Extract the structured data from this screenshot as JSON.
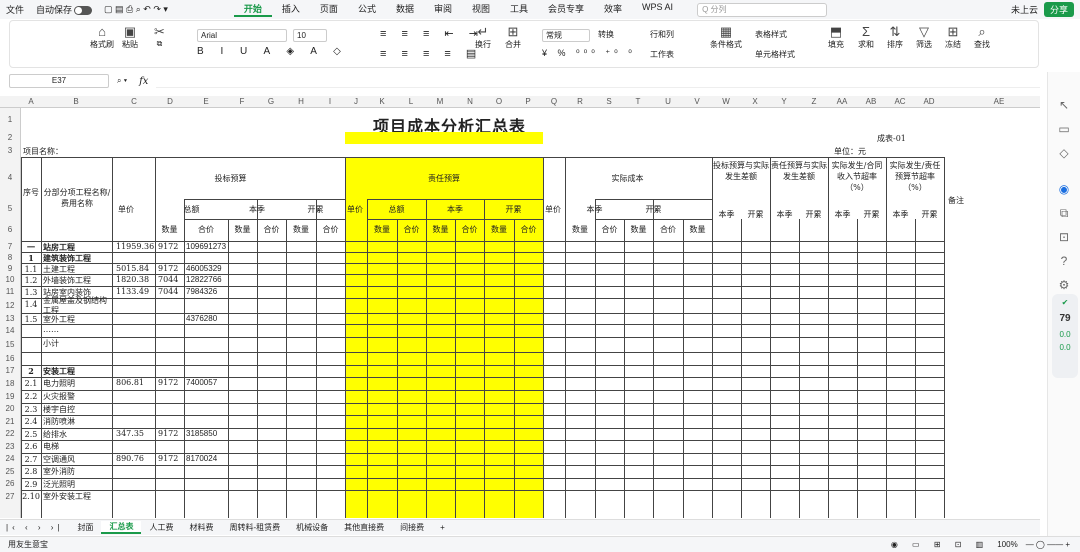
{
  "menubar": {
    "file": "文件",
    "autosave": "自动保存",
    "tabs": [
      "开始",
      "插入",
      "页面",
      "公式",
      "数据",
      "审阅",
      "视图",
      "工具",
      "会员专享",
      "效率",
      "WPS AI"
    ],
    "active_tab": "开始",
    "search_placeholder": "Q 分列",
    "cloud": "未上云",
    "share": "分享"
  },
  "ribbon": {
    "format_painter": "格式刷",
    "paste": "粘贴",
    "font": "Arial",
    "size": "10",
    "wrap": "换行",
    "merge": "合并",
    "number_format": "常规",
    "convert": "转换",
    "rows_cols": "行和列",
    "worksheet": "工作表",
    "cond_format": "条件格式",
    "table_style": "表格样式",
    "cell_style": "单元格样式",
    "fill": "填充",
    "sum": "求和",
    "sort": "排序",
    "filter": "筛选",
    "freeze": "冻结",
    "find": "查找"
  },
  "formula_bar": {
    "cell_ref": "E37",
    "fx": "fx",
    "content": ""
  },
  "columns": [
    "A",
    "B",
    "C",
    "D",
    "E",
    "F",
    "G",
    "H",
    "I",
    "J",
    "K",
    "L",
    "M",
    "N",
    "O",
    "P",
    "Q",
    "R",
    "S",
    "T",
    "U",
    "V",
    "W",
    "X",
    "Y",
    "Z",
    "AA",
    "AB",
    "AC",
    "AD",
    "AE"
  ],
  "rows": [
    "1",
    "2",
    "3",
    "4",
    "5",
    "6",
    "7",
    "8",
    "9",
    "10",
    "11",
    "12",
    "13",
    "14",
    "15",
    "16",
    "17",
    "18",
    "19",
    "20",
    "21",
    "22",
    "23",
    "24",
    "25",
    "26",
    "27"
  ],
  "sheet": {
    "title": "项目成本分析汇总表",
    "project_name_label": "项目名称：",
    "unit_label": "单位：元",
    "form_no": "成表-01",
    "headers": {
      "seq": "序号",
      "item": "分部分项工程名称/费用名称",
      "bid_budget": "投标预算",
      "resp_budget": "责任预算",
      "actual_cost": "实际成本",
      "diff1": "投标预算与实际发生差额",
      "diff2": "责任预算与实际发生差额",
      "rate1": "实际发生/合同收入节超率（%）",
      "rate2": "实际发生/责任预算节超率（%）",
      "remark": "备注",
      "unit_price": "单价",
      "total": "总额",
      "this_quarter": "本季",
      "cumulative": "开累",
      "qty": "数量",
      "amount": "合价"
    },
    "data_rows": [
      {
        "seq": "一",
        "name": "站房工程",
        "price": "11959.36",
        "qty": "9172",
        "amount": "109691273"
      },
      {
        "seq": "1",
        "name": "建筑装饰工程",
        "price": "",
        "qty": "",
        "amount": ""
      },
      {
        "seq": "1.1",
        "name": "土建工程",
        "price": "5015.84",
        "qty": "9172",
        "amount": "46005329"
      },
      {
        "seq": "1.2",
        "name": "外墙装饰工程",
        "price": "1820.38",
        "qty": "7044",
        "amount": "12822766"
      },
      {
        "seq": "1.3",
        "name": "站房室内装饰",
        "price": "1133.49",
        "qty": "7044",
        "amount": "7984326"
      },
      {
        "seq": "1.4",
        "name": "金属屋盖及钢结构工程",
        "price": "",
        "qty": "",
        "amount": ""
      },
      {
        "seq": "1.5",
        "name": "室外工程",
        "price": "",
        "qty": "",
        "amount": "4376280"
      },
      {
        "seq": "",
        "name": "……",
        "price": "",
        "qty": "",
        "amount": ""
      },
      {
        "seq": "",
        "name": "小计",
        "price": "",
        "qty": "",
        "amount": ""
      },
      {
        "seq": "",
        "name": "",
        "price": "",
        "qty": "",
        "amount": ""
      },
      {
        "seq": "2",
        "name": "安装工程",
        "price": "",
        "qty": "",
        "amount": ""
      },
      {
        "seq": "2.1",
        "name": "电力照明",
        "price": "806.81",
        "qty": "9172",
        "amount": "7400057"
      },
      {
        "seq": "2.2",
        "name": "火灾报警",
        "price": "",
        "qty": "",
        "amount": ""
      },
      {
        "seq": "2.3",
        "name": "楼宇自控",
        "price": "",
        "qty": "",
        "amount": ""
      },
      {
        "seq": "2.4",
        "name": "消防喷淋",
        "price": "",
        "qty": "",
        "amount": ""
      },
      {
        "seq": "2.5",
        "name": "给排水",
        "price": "347.35",
        "qty": "9172",
        "amount": "3185850"
      },
      {
        "seq": "2.6",
        "name": "电梯",
        "price": "",
        "qty": "",
        "amount": ""
      },
      {
        "seq": "2.7",
        "name": "空调通风",
        "price": "890.76",
        "qty": "9172",
        "amount": "8170024"
      },
      {
        "seq": "2.8",
        "name": "室外消防",
        "price": "",
        "qty": "",
        "amount": ""
      },
      {
        "seq": "2.9",
        "name": "泛光照明",
        "price": "",
        "qty": "",
        "amount": ""
      },
      {
        "seq": "2.10",
        "name": "室外安装工程",
        "price": "",
        "qty": "",
        "amount": ""
      }
    ]
  },
  "sheet_tabs": [
    "封面",
    "汇总表",
    "人工费",
    "材料费",
    "周转料-租赁费",
    "机械设备",
    "其他直接费",
    "间接费"
  ],
  "active_sheet": "汇总表",
  "status": {
    "left": "用友生意宝",
    "zoom": "100%"
  },
  "right_widget": {
    "score": "79",
    "v1": "0.0",
    "v2": "0.0"
  },
  "colors": {
    "accent": "#1a9a4a",
    "highlight": "#ffff00"
  }
}
